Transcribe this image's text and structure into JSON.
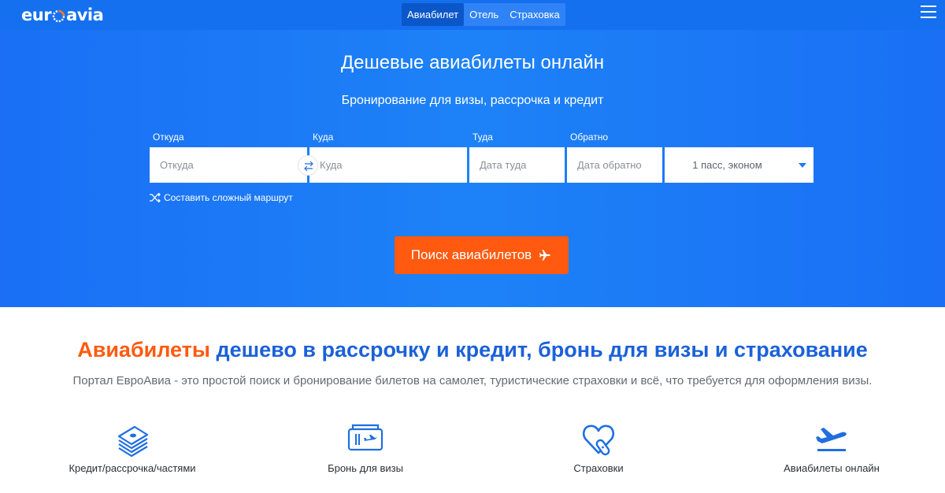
{
  "brand": {
    "logo_text_left": "eur",
    "logo_text_right": "avia"
  },
  "nav": {
    "tabs": [
      {
        "label": "Авиабилет",
        "active": true
      },
      {
        "label": "Отель",
        "active": false
      },
      {
        "label": "Страховка",
        "active": false
      }
    ],
    "menu_icon": "hamburger-icon"
  },
  "hero": {
    "title": "Дешевые авиабилеты онлайн",
    "subtitle": "Бронирование для визы, рассрочка и кредит"
  },
  "search_form": {
    "from": {
      "label": "Откуда",
      "placeholder": "Откуда",
      "value": ""
    },
    "to": {
      "label": "Куда",
      "placeholder": "Куда",
      "value": ""
    },
    "depart": {
      "label": "Туда",
      "placeholder": "Дата туда",
      "value": ""
    },
    "return": {
      "label": "Обратно",
      "placeholder": "Дата обратно",
      "value": ""
    },
    "passengers": {
      "value": "1 пасс, эконом"
    },
    "swap_icon": "swap-arrows-icon",
    "complex_route": {
      "label": "Составить сложный маршрут",
      "icon": "shuffle-icon"
    },
    "submit": {
      "label": "Поиск авиабилетов",
      "icon": "airplane-icon"
    }
  },
  "content": {
    "headline_accent": "Авиабилеты",
    "headline_rest": " дешево в рассрочку и кредит, бронь для визы и страхование",
    "description": "Портал ЕвроАвиа - это простой поиск и бронирование билетов на самолет, туристические страховки и всё, что требуется для оформления визы."
  },
  "features": [
    {
      "label": "Кредит/рассрочка/частями",
      "icon": "money-stack-icon"
    },
    {
      "label": "Бронь для визы",
      "icon": "ticket-icon"
    },
    {
      "label": "Страховки",
      "icon": "heart-bandage-icon"
    },
    {
      "label": "Авиабилеты онлайн",
      "icon": "plane-takeoff-icon"
    }
  ],
  "colors": {
    "hero_blue": "#1d82f7",
    "topbar_blue": "#1570ef",
    "active_tab": "#0b57c9",
    "accent_orange": "#ff5a0f",
    "headline_blue": "#1b61d8",
    "icon_blue": "#1f6fe0"
  }
}
